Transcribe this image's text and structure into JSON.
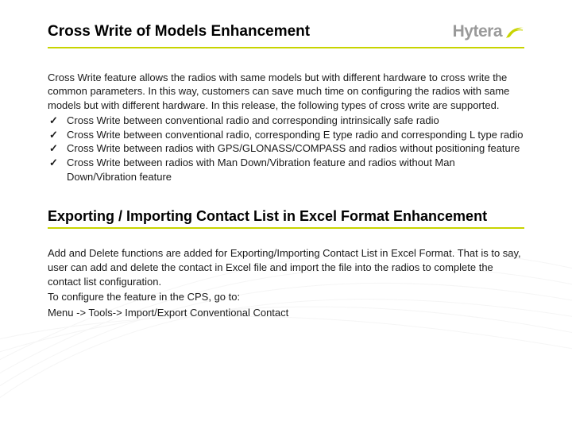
{
  "brand": {
    "name": "Hytera",
    "accent_color": "#c8d400"
  },
  "section1": {
    "title": "Cross Write of Models Enhancement",
    "intro": "Cross Write feature allows the radios with same models but with different hardware to cross write the common parameters. In this way, customers can save much time on configuring the radios with same models but with different hardware. In this release, the following types of cross write are supported.",
    "bullets": [
      "Cross Write between conventional radio and corresponding intrinsically safe radio",
      "Cross Write between conventional radio, corresponding E type radio and corresponding L type radio",
      "Cross Write between radios with GPS/GLONASS/COMPASS and radios without positioning feature",
      "Cross Write between radios with Man Down/Vibration feature and radios without Man Down/Vibration feature"
    ]
  },
  "section2": {
    "title": "Exporting / Importing Contact List in Excel Format Enhancement",
    "para1": "Add and Delete functions are added for Exporting/Importing Contact List in Excel Format. That is to say, user can add and delete the contact in Excel file and import the file into the radios to complete the contact list configuration.",
    "para2": "To configure the feature in the CPS, go to:",
    "para3": "Menu -> Tools-> Import/Export Conventional Contact"
  }
}
